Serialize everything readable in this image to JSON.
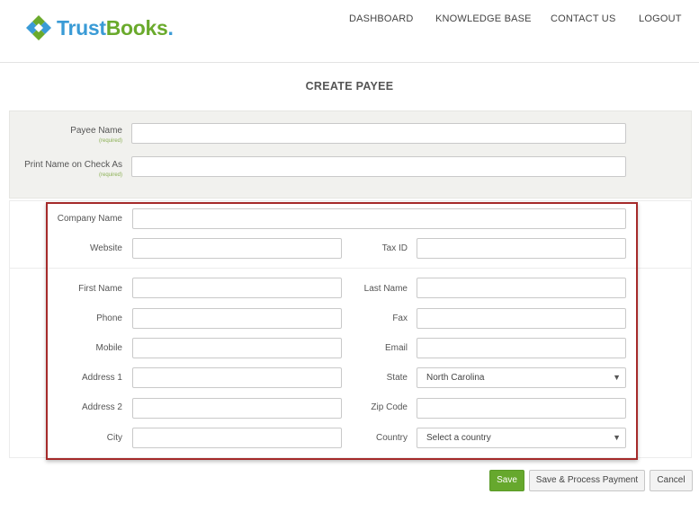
{
  "brand": {
    "name_part1": "Trust",
    "name_part2": "Books",
    "name_dot": "."
  },
  "nav": {
    "dashboard": "DASHBOARD",
    "knowledge_base": "KNOWLEDGE BASE",
    "contact_us": "CONTACT US",
    "logout": "LOGOUT"
  },
  "page": {
    "title": "CREATE PAYEE"
  },
  "form": {
    "required_hint": "(required)",
    "payee_name_label": "Payee Name",
    "print_name_label": "Print Name on Check As",
    "company_name_label": "Company Name",
    "website_label": "Website",
    "tax_id_label": "Tax ID",
    "first_name_label": "First Name",
    "last_name_label": "Last Name",
    "phone_label": "Phone",
    "fax_label": "Fax",
    "mobile_label": "Mobile",
    "email_label": "Email",
    "address1_label": "Address 1",
    "state_label": "State",
    "state_value": "North Carolina",
    "address2_label": "Address 2",
    "zip_label": "Zip Code",
    "city_label": "City",
    "country_label": "Country",
    "country_value": "Select a country"
  },
  "buttons": {
    "save": "Save",
    "save_process": "Save & Process Payment",
    "cancel": "Cancel"
  },
  "colors": {
    "brand_blue": "#3a9bd6",
    "brand_green": "#6aaa2c",
    "save_green": "#66a82d",
    "highlight_red": "#a52a2a"
  }
}
